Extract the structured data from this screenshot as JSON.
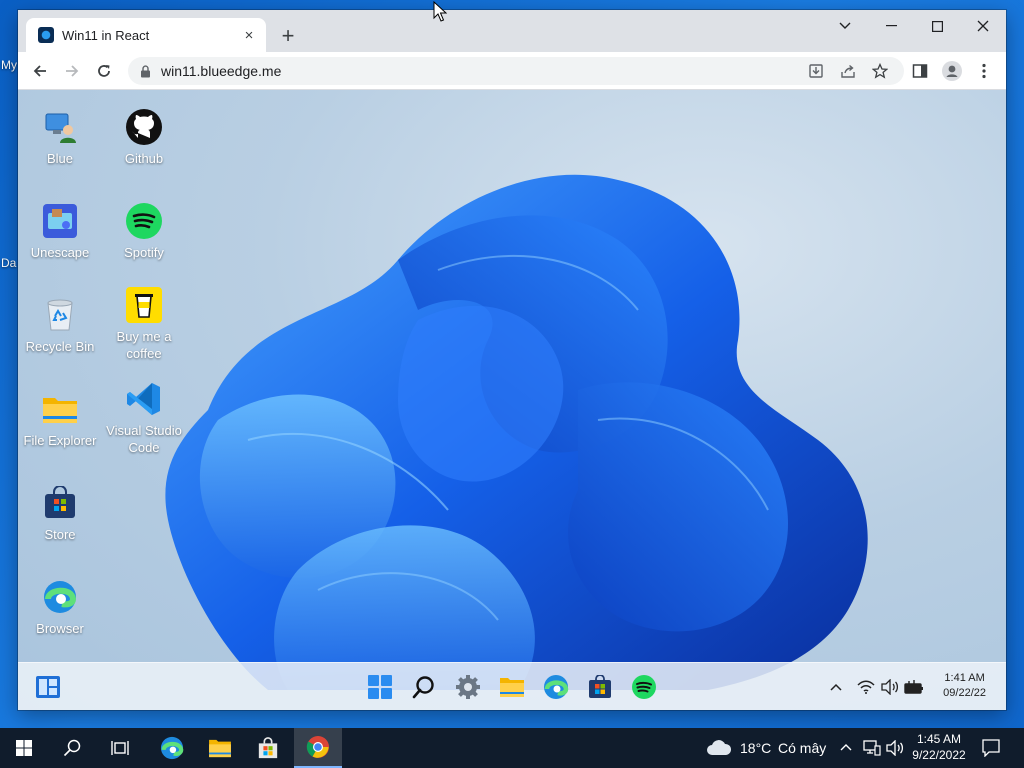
{
  "outer_desktop": {
    "peek_labels": [
      "My",
      "Da"
    ]
  },
  "browser": {
    "tab_title": "Win11 in React",
    "tab_close": "×",
    "new_tab": "+",
    "url": "win11.blueedge.me",
    "window_controls": [
      "chevron-down-icon",
      "minimize-icon",
      "maximize-icon",
      "close-icon"
    ]
  },
  "desktop_icons": [
    {
      "label": "Blue",
      "icon": "user-computer-icon"
    },
    {
      "label": "Github",
      "icon": "github-icon"
    },
    {
      "label": "Unescape",
      "icon": "unescape-game-icon"
    },
    {
      "label": "Spotify",
      "icon": "spotify-icon"
    },
    {
      "label": "Recycle Bin",
      "icon": "recycle-bin-icon"
    },
    {
      "label": "Buy me a coffee",
      "icon": "coffee-cup-icon"
    },
    {
      "label": "File Explorer",
      "icon": "folder-icon"
    },
    {
      "label": "Visual Studio Code",
      "icon": "vscode-icon"
    },
    {
      "label": "Store",
      "icon": "store-bag-icon"
    },
    {
      "label": "Browser",
      "icon": "edge-icon"
    }
  ],
  "win11_taskbar": {
    "widgets": "widgets-icon",
    "pinned": [
      "start-icon",
      "search-icon",
      "settings-icon",
      "file-explorer-icon",
      "edge-icon",
      "store-icon",
      "spotify-icon"
    ],
    "tray": [
      "chevron-up-icon",
      "wifi-icon",
      "volume-icon",
      "battery-icon"
    ],
    "time": "1:41 AM",
    "date": "09/22/22"
  },
  "win10_taskbar": {
    "pinned": [
      "windows-start-icon",
      "search-icon",
      "task-view-icon",
      "edge-icon",
      "file-explorer-icon",
      "store-icon",
      "chrome-icon"
    ],
    "weather_temp": "18°C",
    "weather_text": "Có mây",
    "time": "1:45 AM",
    "date": "9/22/2022"
  },
  "colors": {
    "win11_blue": "#1a6ee8",
    "win10_taskbar": "#101c2c",
    "tabstrip": "#dee1e6"
  }
}
